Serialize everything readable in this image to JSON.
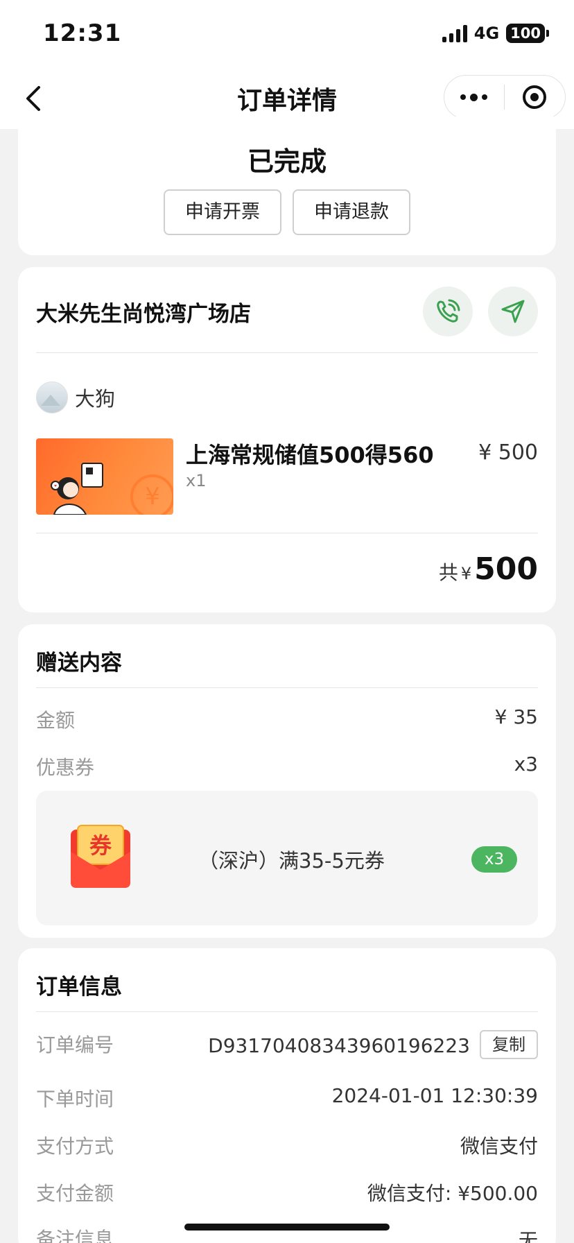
{
  "status_bar": {
    "time": "12:31",
    "network": "4G",
    "battery": "100"
  },
  "nav": {
    "title": "订单详情",
    "back_icon": "chevron-left-icon",
    "more_icon": "more-dots-icon",
    "close_icon": "target-circle-icon"
  },
  "order_status": {
    "status": "已完成",
    "invoice_button": "申请开票",
    "refund_button": "申请退款"
  },
  "store": {
    "name": "大米先生尚悦湾广场店",
    "phone_icon": "phone-icon",
    "navigate_icon": "navigation-arrow-icon",
    "user_name": "大狗",
    "product": {
      "title": "上海常规储值500得560",
      "quantity": "x1",
      "price": "¥ 500"
    },
    "total": {
      "prefix": "共",
      "currency": "¥",
      "amount": "500"
    }
  },
  "gift": {
    "title": "赠送内容",
    "amount_label": "金额",
    "amount_value": "¥ 35",
    "coupon_label": "优惠券",
    "coupon_count": "x3",
    "coupon": {
      "icon": "coupon-envelope-icon",
      "icon_text": "券",
      "name": "（深沪）满35-5元券",
      "badge": "x3"
    }
  },
  "order_info": {
    "title": "订单信息",
    "order_no_label": "订单编号",
    "order_no_value": "D93170408343960196223",
    "copy_button": "复制",
    "time_label": "下单时间",
    "time_value": "2024-01-01 12:30:39",
    "pay_method_label": "支付方式",
    "pay_method_value": "微信支付",
    "pay_amount_label": "支付金额",
    "pay_amount_value": "微信支付: ¥500.00",
    "remark_label": "备注信息",
    "remark_value": "无"
  },
  "colors": {
    "accent_green": "#4cb55f",
    "background": "#f2f2f2",
    "card": "#ffffff"
  }
}
